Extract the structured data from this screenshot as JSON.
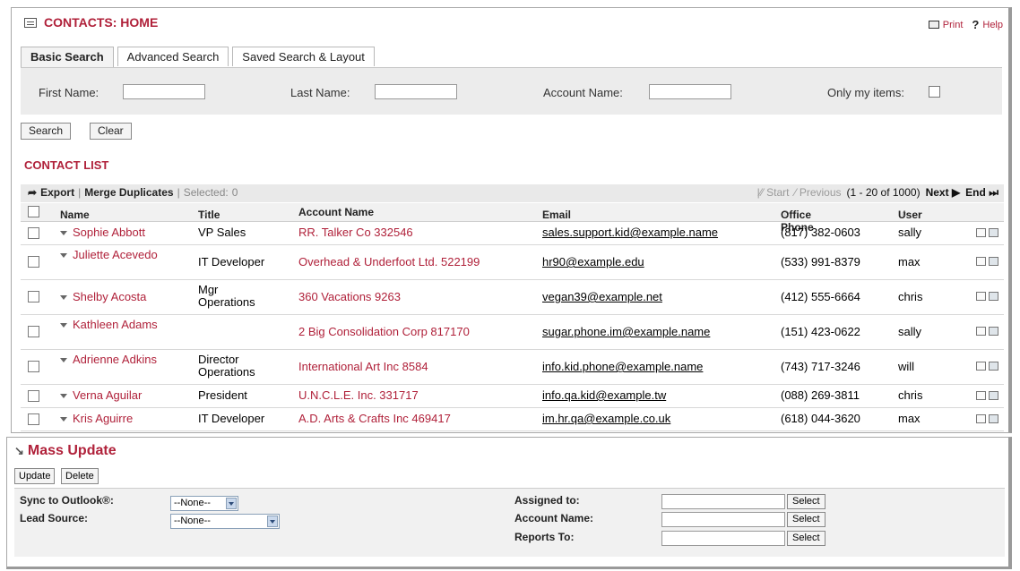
{
  "header": {
    "title": "CONTACTS: HOME",
    "print": "Print",
    "help": "Help"
  },
  "tabs": [
    {
      "label": "Basic Search"
    },
    {
      "label": "Advanced Search"
    },
    {
      "label": "Saved Search & Layout"
    }
  ],
  "search": {
    "first_name_label": "First Name:",
    "last_name_label": "Last Name:",
    "account_name_label": "Account Name:",
    "only_my_items_label": "Only my items:",
    "search_button": "Search",
    "clear_button": "Clear"
  },
  "contact_list": {
    "title": "CONTACT LIST",
    "export": "Export",
    "merge_duplicates": "Merge Duplicates",
    "selected_label": "Selected:",
    "selected_count": "0",
    "start": "Start",
    "previous": "Previous",
    "range": "(1 - 20 of 1000)",
    "next": "Next",
    "end": "End",
    "columns": [
      "Name",
      "Title",
      "Account Name",
      "Email",
      "Office Phone",
      "User"
    ],
    "rows": [
      {
        "name": "Sophie Abbott",
        "title": "VP Sales",
        "account": "RR. Talker Co 332546",
        "email": "sales.support.kid@example.name",
        "phone": "(817) 382-0603",
        "user": "sally"
      },
      {
        "name": "Juliette Acevedo",
        "title": "IT Developer",
        "account": "Overhead & Underfoot Ltd. 522199",
        "email": "hr90@example.edu",
        "phone": "(533) 991-8379",
        "user": "max"
      },
      {
        "name": "Shelby Acosta",
        "title": "Mgr Operations",
        "account": "360 Vacations 9263",
        "email": "vegan39@example.net",
        "phone": "(412) 555-6664",
        "user": "chris"
      },
      {
        "name": "Kathleen Adams",
        "title": "",
        "account": "2 Big Consolidation Corp 817170",
        "email": "sugar.phone.im@example.name",
        "phone": "(151) 423-0622",
        "user": "sally"
      },
      {
        "name": "Adrienne Adkins",
        "title": "Director Operations",
        "account": "International Art Inc 8584",
        "email": "info.kid.phone@example.name",
        "phone": "(743) 717-3246",
        "user": "will"
      },
      {
        "name": "Verna Aguilar",
        "title": "President",
        "account": "U.N.C.L.E. Inc. 331717",
        "email": "info.qa.kid@example.tw",
        "phone": "(088) 269-3811",
        "user": "chris"
      },
      {
        "name": "Kris Aguirre",
        "title": "IT Developer",
        "account": "A.D. Arts & Crafts Inc 469417",
        "email": "im.hr.qa@example.co.uk",
        "phone": "(618) 044-3620",
        "user": "max"
      }
    ]
  },
  "mass_update": {
    "title": "Mass Update",
    "update_button": "Update",
    "delete_button": "Delete",
    "sync_label": "Sync to Outlook®:",
    "sync_value": "--None--",
    "lead_source_label": "Lead Source:",
    "lead_source_value": "--None--",
    "assigned_to_label": "Assigned to:",
    "account_name_label": "Account Name:",
    "reports_to_label": "Reports To:",
    "select_label": "Select"
  }
}
